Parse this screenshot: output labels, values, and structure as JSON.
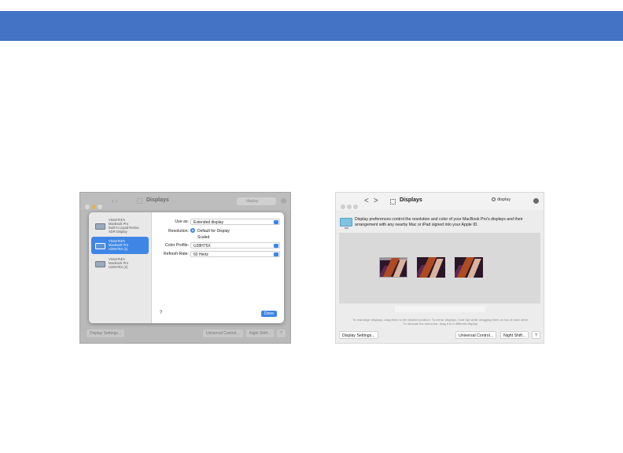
{
  "left_screenshot": {
    "window_title": "Displays",
    "search_value": "display",
    "displays": [
      {
        "line1": "VisionTek's",
        "line2": "MacBook Pro",
        "line3": "Built-in Liquid Retina",
        "line4": "XDR Display",
        "selected": false
      },
      {
        "line1": "VisionTek's",
        "line2": "MacBook Pro",
        "line3": "U28H75X (1)",
        "selected": true
      },
      {
        "line1": "VisionTek's",
        "line2": "MacBook Pro",
        "line3": "U28H75X (2)",
        "selected": false
      }
    ],
    "use_as_label": "Use as:",
    "use_as_value": "Extended display",
    "resolution_label": "Resolution:",
    "resolution_option_default": "Default for Display",
    "resolution_option_scaled": "Scaled",
    "color_profile_label": "Color Profile:",
    "color_profile_value": "U28H75X",
    "refresh_rate_label": "Refresh Rate:",
    "refresh_rate_value": "60 Hertz",
    "help_label": "?",
    "done_label": "Done",
    "bottom_buttons": {
      "display_settings": "Display Settings...",
      "universal_control": "Universal Control...",
      "night_shift": "Night Shift...",
      "help": "?"
    }
  },
  "right_screenshot": {
    "window_title": "Displays",
    "nav_back": "<",
    "nav_forward": ">",
    "search_value": "display",
    "info_text": "Display preferences control the resolution and color of your MacBook Pro's displays and their arrangement with any nearby Mac or iPad signed into your Apple ID.",
    "hint_text": "To rearrange displays, drag them to the desired position. To mirror displays, hold Opt while dragging them on top of each other. To relocate the menu bar, drag it to a different display.",
    "bottom_buttons": {
      "display_settings": "Display Settings...",
      "universal_control": "Universal Control...",
      "night_shift": "Night Shift...",
      "help": "?"
    }
  },
  "colors": {
    "banner": "#4472c4",
    "accent_blue": "#3d86e6"
  }
}
